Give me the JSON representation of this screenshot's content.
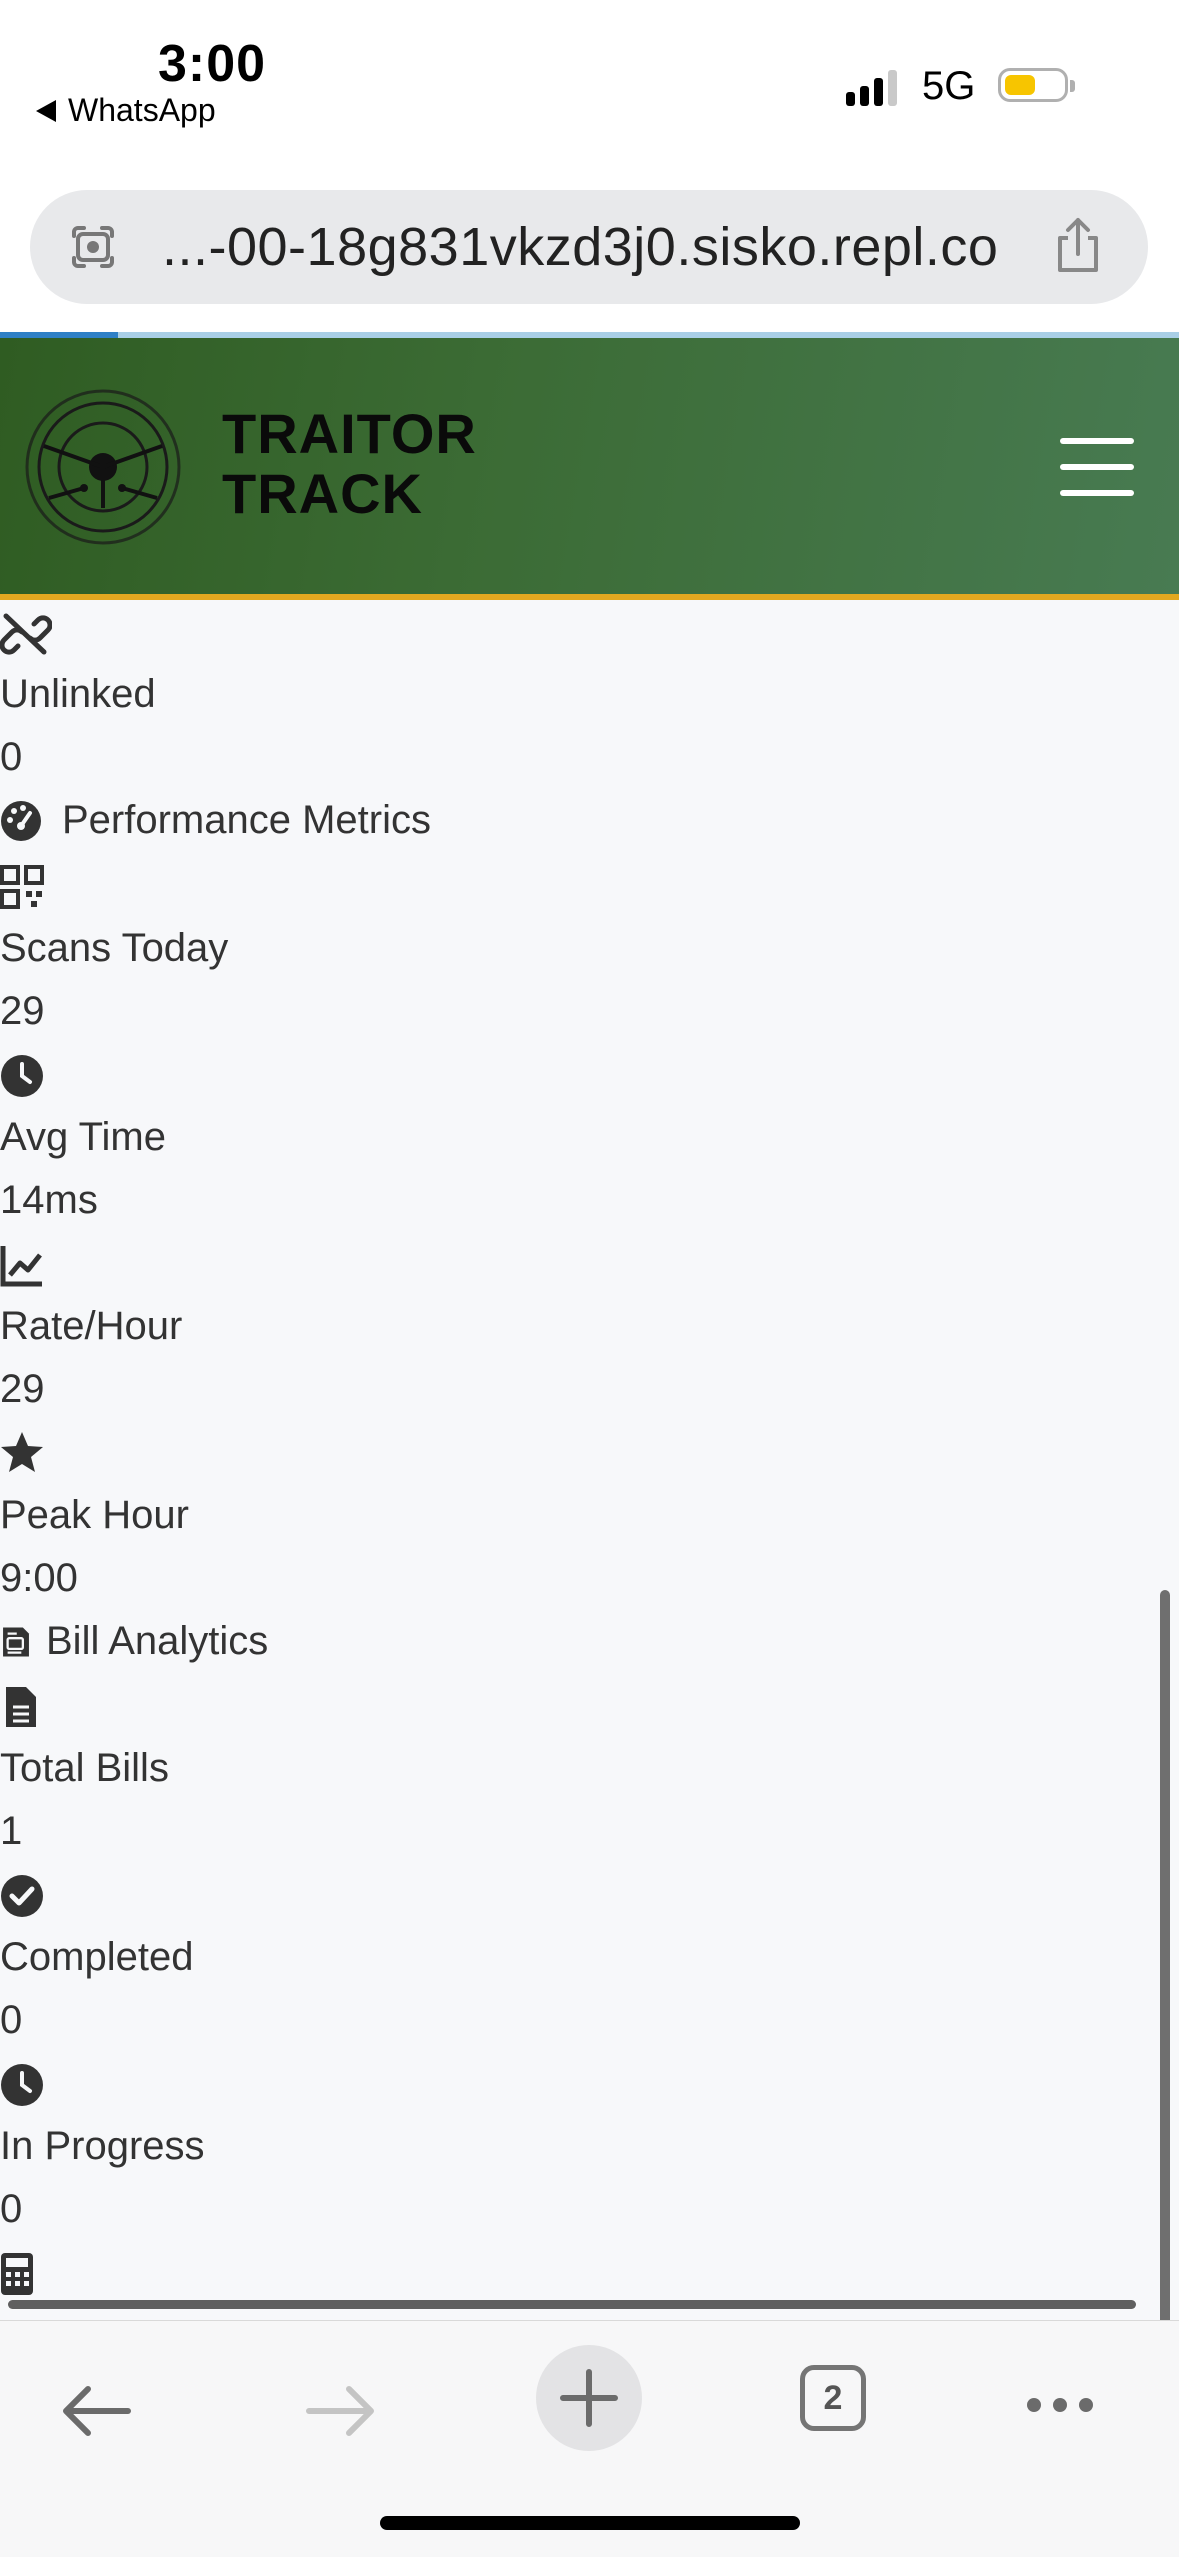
{
  "status_bar": {
    "time": "3:00",
    "back_app": "WhatsApp",
    "network": "5G",
    "battery_color": "#f7c500"
  },
  "browser": {
    "url": "...-00-18g831vkzd3j0.sisko.repl.co",
    "tab_count": "2",
    "page_load_progress": 0.1
  },
  "header": {
    "brand_line1": "TRAITOR",
    "brand_line2": "TRACK",
    "colors": {
      "header_green": "#3b6b34",
      "accent_border": "#e2a820"
    }
  },
  "content": {
    "unlinked": {
      "icon": "unlink-icon",
      "label": "Unlinked",
      "value": "0"
    },
    "performance": {
      "title": "Performance Metrics",
      "icon": "gauge-icon",
      "metrics": [
        {
          "icon": "qrcode-icon",
          "label": "Scans Today",
          "value": "29"
        },
        {
          "icon": "clock-icon",
          "label": "Avg Time",
          "value": "14ms"
        },
        {
          "icon": "line-chart-icon",
          "label": "Rate/Hour",
          "value": "29"
        },
        {
          "icon": "star-icon",
          "label": "Peak Hour",
          "value": "9:00"
        }
      ]
    },
    "bills": {
      "title": "Bill Analytics",
      "icon": "receipt-icon",
      "metrics": [
        {
          "icon": "file-text-icon",
          "label": "Total Bills",
          "value": "1"
        },
        {
          "icon": "check-circle-icon",
          "label": "Completed",
          "value": "0"
        },
        {
          "icon": "clock-icon",
          "label": "In Progress",
          "value": "0"
        }
      ],
      "next_icon": "calculator-icon"
    }
  }
}
